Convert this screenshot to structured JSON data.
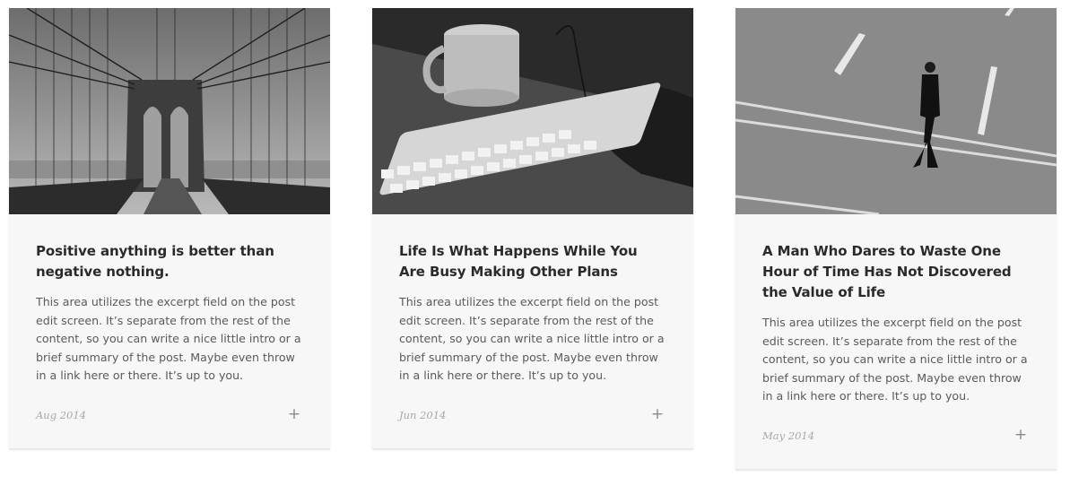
{
  "posts": [
    {
      "title": "Positive anything is better than negative nothing.",
      "excerpt_before": "This area utilizes the excerpt field on the post edit screen. It’s separate from the rest of the content, so you can write a nice little intro or a brief summary of the post. Maybe even throw in a link ",
      "link_here": "here",
      "text_or": " or ",
      "link_there": "there",
      "excerpt_after": ". It’s up to you.",
      "date": "Aug 2014",
      "more_icon": "+",
      "image": "bridge-photo"
    },
    {
      "title": "Life Is What Happens While You Are Busy Making Other Plans",
      "excerpt_before": "This area utilizes the excerpt field on the post edit screen. It’s separate from the rest of the content, so you can write a nice little intro or a brief summary of the post. Maybe even throw in a link ",
      "link_here": "here",
      "text_or": " or ",
      "link_there": "there",
      "excerpt_after": ". It’s up to you.",
      "date": "Jun 2014",
      "more_icon": "+",
      "image": "keyboard-mug-photo"
    },
    {
      "title": "A Man Who Dares to Waste One Hour of Time Has Not Discovered the Value of Life",
      "excerpt_before": "This area utilizes the excerpt field on the post edit screen. It’s separate from the rest of the content, so you can write a nice little intro or a brief summary of the post. Maybe even throw in a link ",
      "link_here": "here",
      "text_or": " or ",
      "link_there": "there",
      "excerpt_after": ". It’s up to you.",
      "date": "May 2014",
      "more_icon": "+",
      "image": "man-walking-street-photo"
    }
  ]
}
